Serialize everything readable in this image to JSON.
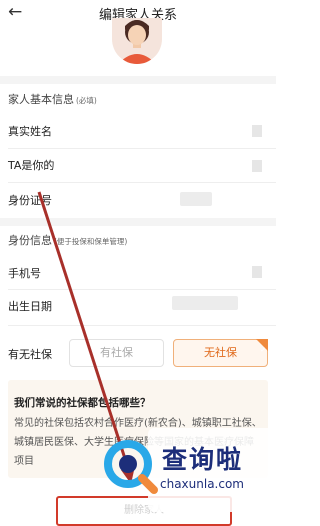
{
  "header": {
    "back_icon": "arrow-left-icon",
    "title": "编辑家人关系"
  },
  "basic": {
    "section_title": "家人基本信息",
    "section_hint": "(必填)",
    "fields": [
      {
        "label": "真实姓名"
      },
      {
        "label": "TA是你的"
      },
      {
        "label": "身份证号"
      }
    ]
  },
  "identity": {
    "section_title": "身份信息",
    "section_hint": "(便于投保和保单管理)",
    "fields": [
      {
        "label": "手机号"
      },
      {
        "label": "出生日期"
      }
    ]
  },
  "social": {
    "label": "有无社保",
    "options": [
      {
        "label": "有社保",
        "selected": false
      },
      {
        "label": "无社保",
        "selected": true
      }
    ]
  },
  "info": {
    "title": "我们常说的社保都包括哪些？",
    "body": "常见的社保包括农村合作医疗(新农合)、城镇职工社保、城镇居民医保、大学生医疗保险等国家的基本医疗保障项目"
  },
  "bottom": {
    "button_label": "删除家人"
  },
  "watermark": {
    "brand": "查询啦",
    "url": "chaxunla.com"
  },
  "colors": {
    "accent": "#e0691a",
    "pointer": "#a8302a",
    "highlight": "#d23a2a"
  }
}
